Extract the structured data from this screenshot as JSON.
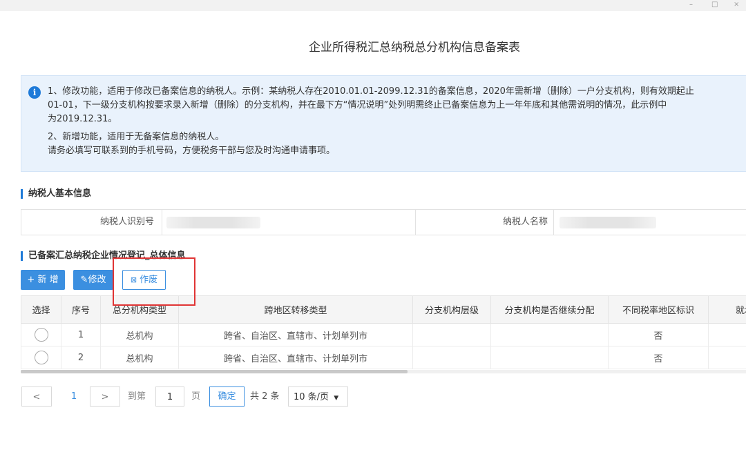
{
  "window": {
    "minimize": "–",
    "maximize": "□",
    "close": "×"
  },
  "page": {
    "title": "企业所得税汇总纳税总分机构信息备案表"
  },
  "notice": {
    "line1": "1、修改功能，适用于修改已备案信息的纳税人。示例：某纳税人存在2010.01.01-2099.12.31的备案信息，2020年需新增（删除）一户分支机构，则有效期起止",
    "line2": "01-01，下一级分支机构按要求录入新增（删除）的分支机构，并在最下方“情况说明”处列明需终止已备案信息为上一年年底和其他需说明的情况，此示例中",
    "line3": "为2019.12.31。",
    "line4": "2、新增功能，适用于无备案信息的纳税人。",
    "line5": "请务必填写可联系到的手机号码，方便税务干部与您及时沟通申请事项。"
  },
  "taxpayer": {
    "section_title": "纳税人基本信息",
    "id_label": "纳税人识别号",
    "name_label": "纳税人名称"
  },
  "records": {
    "section_title": "已备案汇总纳税企业情况登记_总体信息",
    "add_label": "+ 新 增",
    "edit_label": "修改",
    "void_label": "作废",
    "columns": [
      "选择",
      "序号",
      "总分机构类型",
      "跨地区转移类型",
      "分支机构层级",
      "分支机构是否继续分配",
      "不同税率地区标识",
      "就地"
    ],
    "rows": [
      {
        "seq": "1",
        "org_type": "总机构",
        "transfer_type": "跨省、自治区、直辖市、计划单列市",
        "level": "",
        "continue_alloc": "",
        "rate_flag": "否"
      },
      {
        "seq": "2",
        "org_type": "总机构",
        "transfer_type": "跨省、自治区、直辖市、计划单列市",
        "level": "",
        "continue_alloc": "",
        "rate_flag": "否"
      }
    ]
  },
  "pager": {
    "prev": "<",
    "current_page": "1",
    "next": ">",
    "goto_label": "到第",
    "goto_value": "1",
    "page_unit": "页",
    "confirm_label": "确定",
    "total_label": "共 2 条",
    "page_size_label": "10 条/页",
    "dropdown_caret": "▼"
  }
}
